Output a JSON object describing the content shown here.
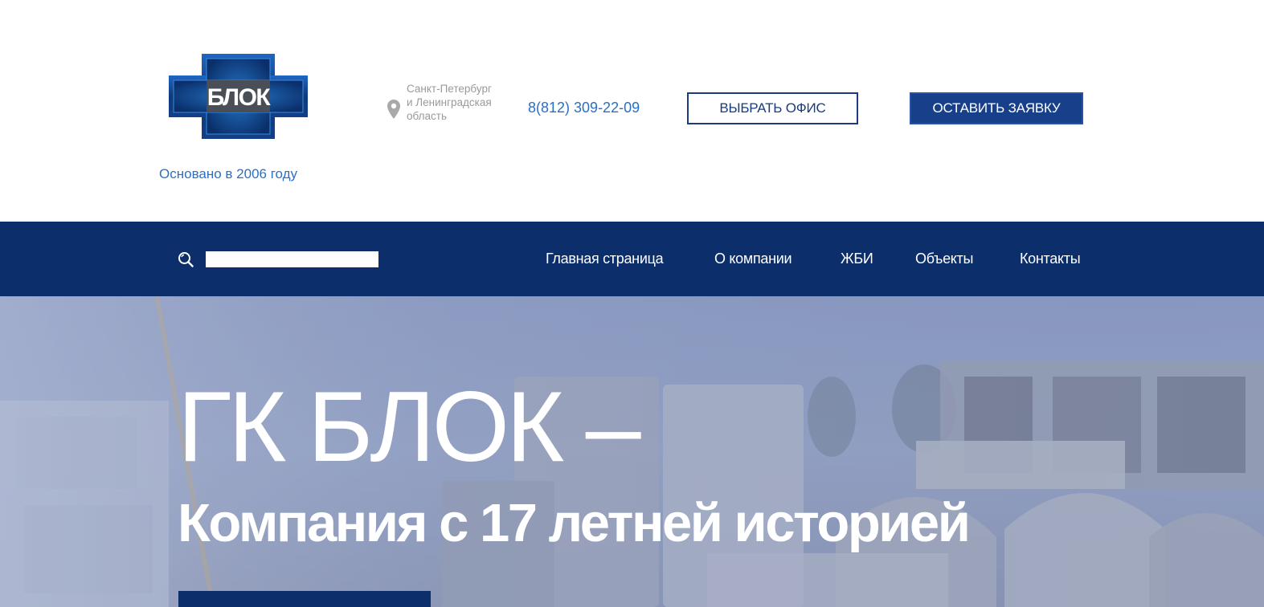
{
  "header": {
    "logo_text": "БЛОК",
    "founded": "Основано в 2006 году",
    "location": "Санкт-Петербург и Ленинградская область",
    "phone": "8(812) 309-22-09",
    "choose_office_label": "ВЫБРАТЬ ОФИС",
    "leave_request_label": "ОСТАВИТЬ ЗАЯВКУ"
  },
  "nav": {
    "search_placeholder": "",
    "items": [
      "Главная страница",
      "О компании",
      "ЖБИ",
      "Объекты",
      "Контакты"
    ]
  },
  "hero": {
    "title": "ГК БЛОК –",
    "subtitle": "Компания с 17 летней историей"
  },
  "icons": {
    "location": "map-pin-icon",
    "search": "search-icon"
  },
  "colors": {
    "brand_dark_blue": "#0c2e6b",
    "button_blue": "#173f8a",
    "link_blue": "#2b6fc4",
    "muted_text": "#9a9a9a"
  }
}
